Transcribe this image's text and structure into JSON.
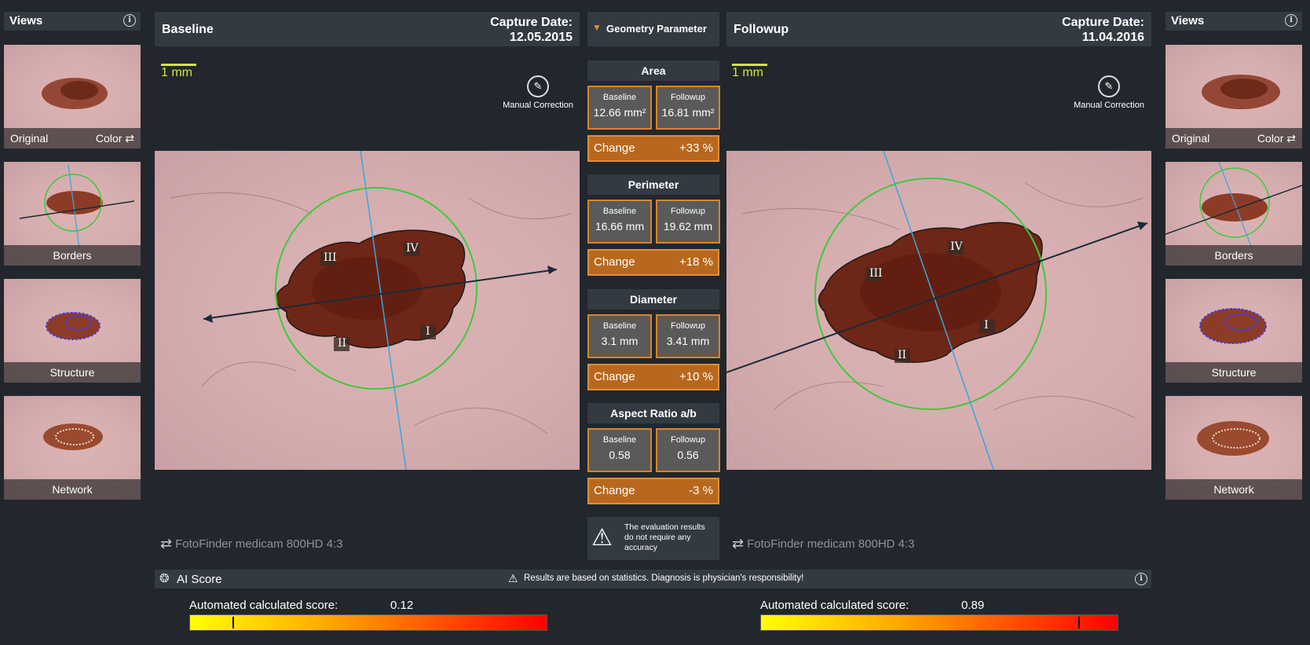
{
  "left_views": {
    "title": "Views",
    "items": [
      {
        "label": "Original",
        "label2": "Color"
      },
      {
        "label": "Borders"
      },
      {
        "label": "Structure"
      },
      {
        "label": "Network"
      }
    ]
  },
  "right_views": {
    "title": "Views",
    "items": [
      {
        "label": "Original",
        "label2": "Color"
      },
      {
        "label": "Borders"
      },
      {
        "label": "Structure"
      },
      {
        "label": "Network"
      }
    ]
  },
  "baseline": {
    "title": "Baseline",
    "capture_label": "Capture Date:",
    "capture_date": "12.05.2015",
    "scale": "1 mm",
    "manual_correction": "Manual Correction",
    "camera": "FotoFinder medicam 800HD 4:3"
  },
  "followup": {
    "title": "Followup",
    "capture_label": "Capture Date:",
    "capture_date": "11.04.2016",
    "scale": "1 mm",
    "manual_correction": "Manual Correction",
    "camera": "FotoFinder medicam 800HD 4:3"
  },
  "geometry": {
    "header": "Geometry Parameter",
    "sections": [
      {
        "title": "Area",
        "baseline_label": "Baseline",
        "baseline": "12.66 mm²",
        "followup_label": "Followup",
        "followup": "16.81 mm²",
        "change_label": "Change",
        "change": "+33 %"
      },
      {
        "title": "Perimeter",
        "baseline_label": "Baseline",
        "baseline": "16.66 mm",
        "followup_label": "Followup",
        "followup": "19.62 mm",
        "change_label": "Change",
        "change": "+18 %"
      },
      {
        "title": "Diameter",
        "baseline_label": "Baseline",
        "baseline": "3.1 mm",
        "followup_label": "Followup",
        "followup": "3.41 mm",
        "change_label": "Change",
        "change": "+10 %"
      },
      {
        "title": "Aspect Ratio a/b",
        "baseline_label": "Baseline",
        "baseline": "0.58",
        "followup_label": "Followup",
        "followup": "0.56",
        "change_label": "Change",
        "change": "-3 %"
      }
    ],
    "warning": "The evaluation results do not require any accuracy"
  },
  "ai": {
    "title": "AI Score",
    "disclaimer": "Results are based on statistics. Diagnosis is physician's responsibility!",
    "baseline_label": "Automated calculated score:",
    "baseline_score": "0.12",
    "baseline_value": 0.12,
    "followup_label": "Automated calculated score:",
    "followup_score": "0.89",
    "followup_value": 0.89
  },
  "lesion_labels": {
    "i": "I",
    "ii": "II",
    "iii": "III",
    "iv": "IV"
  },
  "colors": {
    "accent": "#d9852c",
    "change_bg": "#b8681e",
    "scale": "#d4e04a",
    "circle": "#3ec93e",
    "axis": "#3aa5e0",
    "arrow": "#1b2a38"
  }
}
